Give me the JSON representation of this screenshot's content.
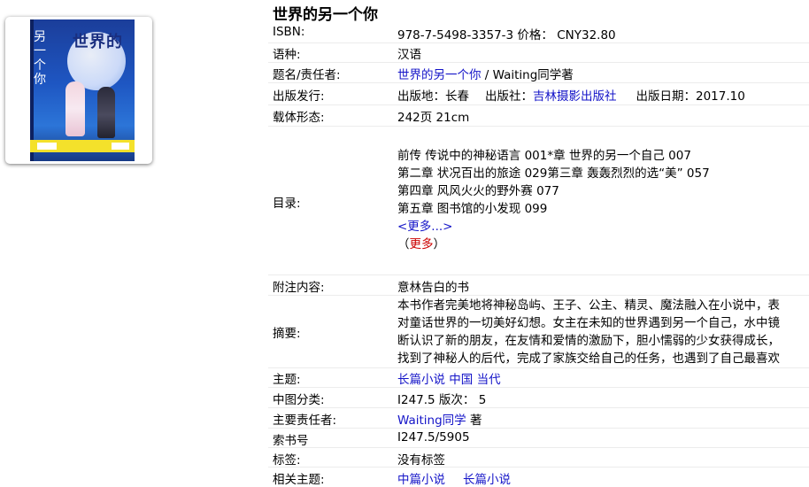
{
  "book": {
    "title": "世界的另一个你",
    "cover": {
      "title_glyphs": "世界的",
      "side_glyphs": "另一个你"
    },
    "fields": {
      "isbn": {
        "label": "ISBN:",
        "value": "978-7-5498-3357-3 价格： CNY32.80"
      },
      "language": {
        "label": "语种:",
        "value": "汉语"
      },
      "title_resp": {
        "label": "题名/责任者:",
        "title_link": "世界的另一个你",
        "rest": " / Waiting同学著"
      },
      "publish": {
        "label": "出版发行:",
        "place_label": "出版地：",
        "place": "长春",
        "publisher_label": "出版社：",
        "publisher": "吉林摄影出版社",
        "date_label": "出版日期：",
        "date": "2017.10"
      },
      "carrier": {
        "label": "载体形态:",
        "value": "242页 21cm"
      },
      "toc": {
        "label": "目录:",
        "lines": [
          "前传 传说中的神秘语言 001*章 世界的另一个自己 007",
          "第二章 状况百出的旅途 029第三章 轰轰烈烈的选“美” 057",
          "第四章 风风火火的野外赛 077",
          "第五章 图书馆的小发现 099"
        ],
        "more_link": "<更多...>",
        "more_red_open": "（",
        "more_red": "更多",
        "more_red_close": "）"
      },
      "note": {
        "label": "附注内容:",
        "value": "意林告白的书"
      },
      "abstract": {
        "label": "摘要:",
        "lines": [
          "本书作者完美地将神秘岛屿、王子、公主、精灵、魔法融入在小说中，表",
          "对童话世界的一切美好幻想。女主在未知的世界遇到另一个自己，水中镜",
          "断认识了新的朋友，在友情和爱情的激励下，胆小懦弱的少女获得成长，",
          "找到了神秘人的后代，完成了家族交给自己的任务，也遇到了自己最喜欢"
        ]
      },
      "subject": {
        "label": "主题:",
        "link1": "长篇小说",
        "link2": "中国",
        "link3": "当代"
      },
      "clc": {
        "label": "中图分类:",
        "value": "I247.5 版次： 5"
      },
      "author": {
        "label": "主要责任者:",
        "link": "Waiting同学",
        "rest": " 著"
      },
      "callno": {
        "label": "索书号",
        "value": "I247.5/5905"
      },
      "tags": {
        "label": "标签:",
        "value": "没有标签"
      },
      "related": {
        "label": "相关主题:",
        "link1": "中篇小说",
        "link2": "长篇小说"
      }
    }
  },
  "colors": {
    "link": "#1414c8",
    "red": "#cc0000"
  }
}
